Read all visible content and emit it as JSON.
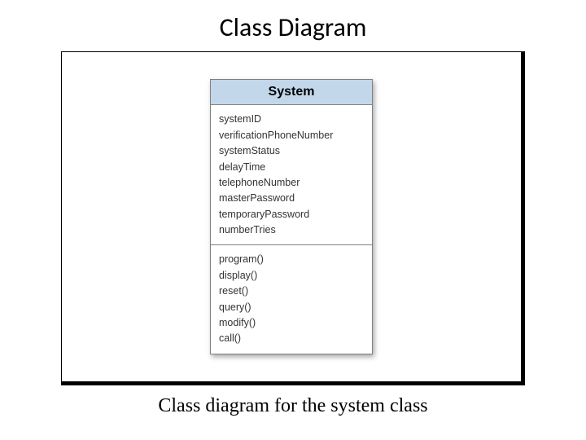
{
  "title": "Class Diagram",
  "caption": "Class diagram for the system class",
  "uml": {
    "className": "System",
    "attributes": [
      "systemID",
      "verificationPhoneNumber",
      "systemStatus",
      "delayTime",
      "telephoneNumber",
      "masterPassword",
      "temporaryPassword",
      "numberTries"
    ],
    "operations": [
      "program()",
      "display()",
      "reset()",
      "query()",
      "modify()",
      "call()"
    ]
  }
}
